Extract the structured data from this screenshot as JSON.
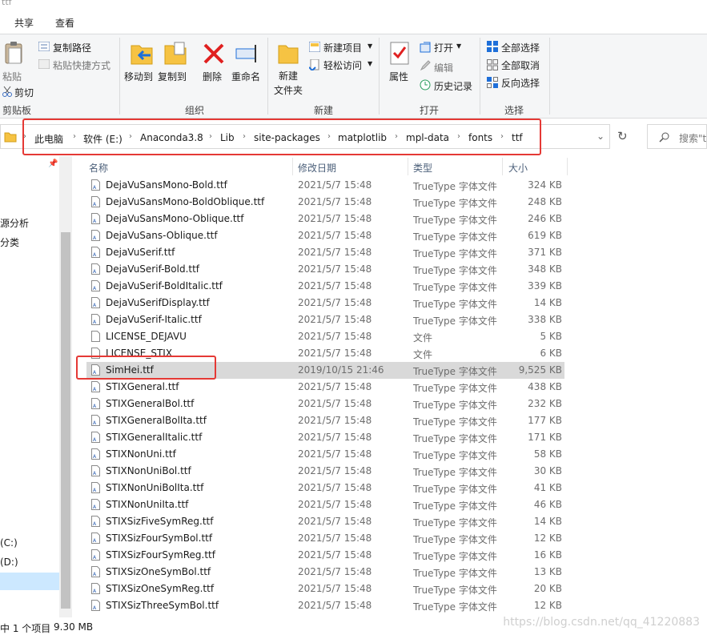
{
  "window": {
    "title": "ttf"
  },
  "tabs": [
    "共享",
    "查看"
  ],
  "ribbon": {
    "clipboard": {
      "paste": "粘贴",
      "copy_path": "复制路径",
      "paste_shortcut": "粘贴快捷方式",
      "cut": "剪切",
      "group": "剪贴板"
    },
    "organize": {
      "move_to": "移动到",
      "copy_to": "复制到",
      "delete": "删除",
      "rename": "重命名",
      "group": "组织"
    },
    "new": {
      "new_folder": "新建\n文件夹",
      "new_item": "新建项目",
      "easy_access": "轻松访问",
      "group": "新建"
    },
    "open": {
      "properties": "属性",
      "open": "打开",
      "edit": "编辑",
      "history": "历史记录",
      "group": "打开"
    },
    "select": {
      "select_all": "全部选择",
      "select_none": "全部取消",
      "invert": "反向选择",
      "group": "选择"
    }
  },
  "address": {
    "crumbs": [
      "此电脑",
      "软件 (E:)",
      "Anaconda3.8",
      "Lib",
      "site-packages",
      "matplotlib",
      "mpl-data",
      "fonts",
      "ttf"
    ],
    "search_placeholder": "搜索\"t"
  },
  "nav": {
    "items": [
      "源分析",
      "分类",
      "(C:)",
      "(D:)"
    ]
  },
  "columns": {
    "name": "名称",
    "date": "修改日期",
    "type": "类型",
    "size": "大小"
  },
  "files": [
    {
      "name": "DejaVuSansMono-Bold.ttf",
      "date": "2021/5/7 15:48",
      "type": "TrueType 字体文件",
      "size": "324 KB",
      "kind": "font"
    },
    {
      "name": "DejaVuSansMono-BoldOblique.ttf",
      "date": "2021/5/7 15:48",
      "type": "TrueType 字体文件",
      "size": "248 KB",
      "kind": "font"
    },
    {
      "name": "DejaVuSansMono-Oblique.ttf",
      "date": "2021/5/7 15:48",
      "type": "TrueType 字体文件",
      "size": "246 KB",
      "kind": "font"
    },
    {
      "name": "DejaVuSans-Oblique.ttf",
      "date": "2021/5/7 15:48",
      "type": "TrueType 字体文件",
      "size": "619 KB",
      "kind": "font"
    },
    {
      "name": "DejaVuSerif.ttf",
      "date": "2021/5/7 15:48",
      "type": "TrueType 字体文件",
      "size": "371 KB",
      "kind": "font"
    },
    {
      "name": "DejaVuSerif-Bold.ttf",
      "date": "2021/5/7 15:48",
      "type": "TrueType 字体文件",
      "size": "348 KB",
      "kind": "font"
    },
    {
      "name": "DejaVuSerif-BoldItalic.ttf",
      "date": "2021/5/7 15:48",
      "type": "TrueType 字体文件",
      "size": "339 KB",
      "kind": "font"
    },
    {
      "name": "DejaVuSerifDisplay.ttf",
      "date": "2021/5/7 15:48",
      "type": "TrueType 字体文件",
      "size": "14 KB",
      "kind": "font"
    },
    {
      "name": "DejaVuSerif-Italic.ttf",
      "date": "2021/5/7 15:48",
      "type": "TrueType 字体文件",
      "size": "338 KB",
      "kind": "font"
    },
    {
      "name": "LICENSE_DEJAVU",
      "date": "2021/5/7 15:48",
      "type": "文件",
      "size": "5 KB",
      "kind": "file"
    },
    {
      "name": "LICENSE_STIX",
      "date": "2021/5/7 15:48",
      "type": "文件",
      "size": "6 KB",
      "kind": "file"
    },
    {
      "name": "SimHei.ttf",
      "date": "2019/10/15 21:46",
      "type": "TrueType 字体文件",
      "size": "9,525 KB",
      "kind": "font",
      "selected": true
    },
    {
      "name": "STIXGeneral.ttf",
      "date": "2021/5/7 15:48",
      "type": "TrueType 字体文件",
      "size": "438 KB",
      "kind": "font"
    },
    {
      "name": "STIXGeneralBol.ttf",
      "date": "2021/5/7 15:48",
      "type": "TrueType 字体文件",
      "size": "232 KB",
      "kind": "font"
    },
    {
      "name": "STIXGeneralBolIta.ttf",
      "date": "2021/5/7 15:48",
      "type": "TrueType 字体文件",
      "size": "177 KB",
      "kind": "font"
    },
    {
      "name": "STIXGeneralItalic.ttf",
      "date": "2021/5/7 15:48",
      "type": "TrueType 字体文件",
      "size": "171 KB",
      "kind": "font"
    },
    {
      "name": "STIXNonUni.ttf",
      "date": "2021/5/7 15:48",
      "type": "TrueType 字体文件",
      "size": "58 KB",
      "kind": "font"
    },
    {
      "name": "STIXNonUniBol.ttf",
      "date": "2021/5/7 15:48",
      "type": "TrueType 字体文件",
      "size": "30 KB",
      "kind": "font"
    },
    {
      "name": "STIXNonUniBolIta.ttf",
      "date": "2021/5/7 15:48",
      "type": "TrueType 字体文件",
      "size": "41 KB",
      "kind": "font"
    },
    {
      "name": "STIXNonUniIta.ttf",
      "date": "2021/5/7 15:48",
      "type": "TrueType 字体文件",
      "size": "46 KB",
      "kind": "font"
    },
    {
      "name": "STIXSizFiveSymReg.ttf",
      "date": "2021/5/7 15:48",
      "type": "TrueType 字体文件",
      "size": "14 KB",
      "kind": "font"
    },
    {
      "name": "STIXSizFourSymBol.ttf",
      "date": "2021/5/7 15:48",
      "type": "TrueType 字体文件",
      "size": "12 KB",
      "kind": "font"
    },
    {
      "name": "STIXSizFourSymReg.ttf",
      "date": "2021/5/7 15:48",
      "type": "TrueType 字体文件",
      "size": "16 KB",
      "kind": "font"
    },
    {
      "name": "STIXSizOneSymBol.ttf",
      "date": "2021/5/7 15:48",
      "type": "TrueType 字体文件",
      "size": "13 KB",
      "kind": "font"
    },
    {
      "name": "STIXSizOneSymReg.ttf",
      "date": "2021/5/7 15:48",
      "type": "TrueType 字体文件",
      "size": "20 KB",
      "kind": "font"
    },
    {
      "name": "STIXSizThreeSymBol.ttf",
      "date": "2021/5/7 15:48",
      "type": "TrueType 字体文件",
      "size": "12 KB",
      "kind": "font"
    }
  ],
  "status": {
    "selection": "中 1 个项目",
    "size": "9.30 MB",
    "watermark": "https://blog.csdn.net/qq_41220883"
  },
  "colors": {
    "highlight_red": "#e53935",
    "selected_row": "#d9d9d9",
    "accent_blue": "#1e6fd9"
  }
}
